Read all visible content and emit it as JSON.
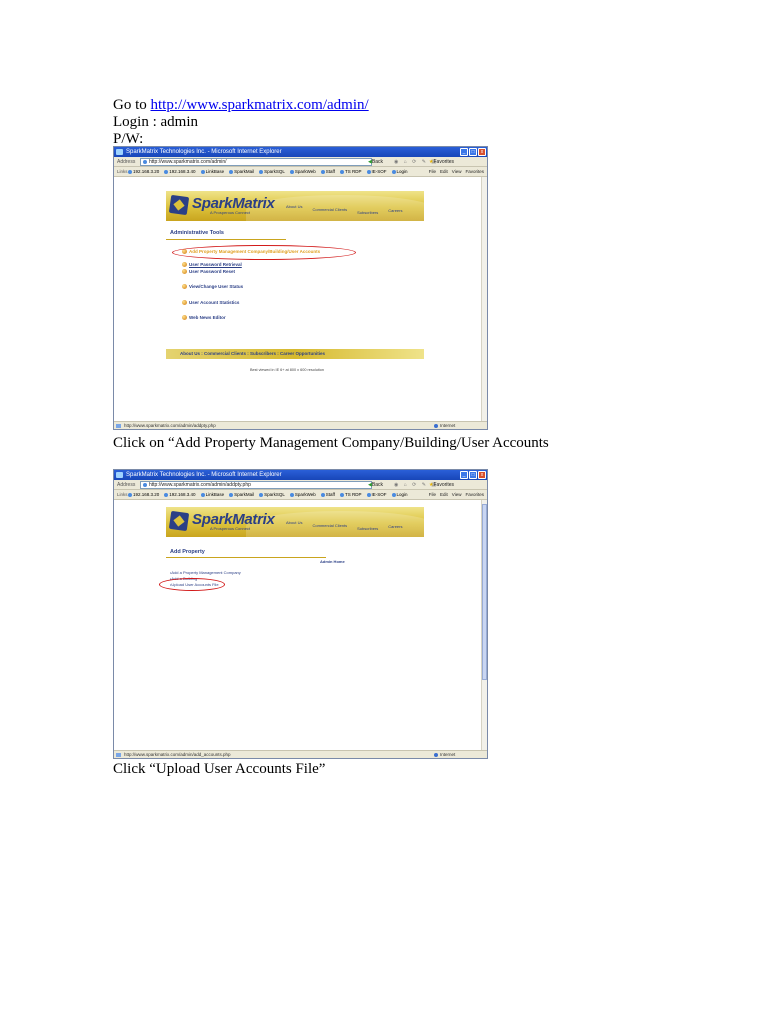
{
  "instructions": {
    "goto_prefix": "Go to ",
    "url": "http://www.sparkmatrix.com/admin/",
    "login": "Login :  admin",
    "pw": "P/W:",
    "step1": "Click on “Add Property Management Company/Building/User Accounts",
    "step2": "Click “Upload User Accounts File”"
  },
  "browser": {
    "title": "SparkMatrix Technologies Inc. - Microsoft Internet Explorer",
    "address_label": "Address",
    "back_label": "Back",
    "favorites_label": "Favorites",
    "links_label": "Links",
    "links": [
      "192.168.3.20",
      "192.168.3.40",
      "LinkBase",
      "SparkMail",
      "SparkSQL",
      "SparkWeb",
      "Staff",
      "TS RDP",
      "IE-SOF",
      "Login"
    ],
    "menu": [
      "File",
      "Edit",
      "View",
      "Favorites"
    ],
    "zone": "Internet"
  },
  "shot1": {
    "address": "http://www.sparkmatrix.com/admin/",
    "status_url": "http://www.sparkmatrix.com/admin/addpty.php",
    "section_title": "Administrative Tools",
    "items": [
      "Add Property Management Company/Building/User Accounts",
      "User Password Retrieval",
      "User Password Reset",
      "View/Change User Status",
      "User Account Statistics",
      "Web News Editor"
    ],
    "footer_links": "About Us :  Commercial Clients :  Subscribers :  Career Opportunities",
    "best_viewed": "Best viewed in IE 6+ at 800 x 600 resolution"
  },
  "shot2": {
    "address": "http://www.sparkmatrix.com/admin/addpty.php",
    "status_url": "http://www.sparkmatrix.com/admin/add_accounts.php",
    "section_title": "Add Property",
    "admin_home": "Admin Home",
    "links": [
      "Add a Property Management Company",
      "Add a Building",
      "Upload User Accounts File"
    ]
  },
  "site": {
    "logo_text": "SparkMatrix",
    "tagline": "A Prosperous Connect",
    "nav": [
      "About Us",
      "Commercial Clients",
      "Subscribers",
      "Careers"
    ]
  },
  "colors": {
    "annotation_red": "#d21a1a",
    "brand_navy": "#2b3f86",
    "banner_gold": "#dcc23c",
    "link_blue": "#0000ee"
  }
}
